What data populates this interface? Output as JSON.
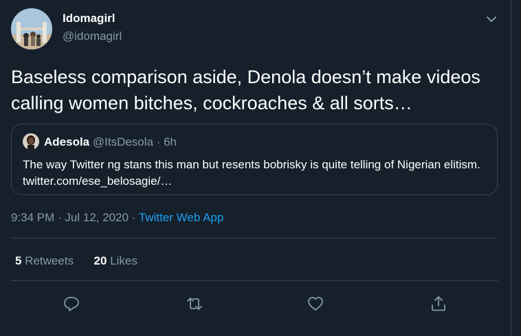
{
  "tweet": {
    "author_name": "Idomagirl",
    "author_handle": "@idomagirl",
    "text": "Baseless comparison aside, Denola doesn’t make videos calling women bitches, cockroaches & all sorts…",
    "timestamp": "9:34 PM · Jul 12, 2020 · ",
    "source": "Twitter Web App"
  },
  "quoted": {
    "name": "Adesola",
    "meta": "@ItsDesola · 6h",
    "text": "The way Twitter ng stans this man but resents bobrisky is quite telling of Nigerian elitism. twitter.com/ese_belosagie/…"
  },
  "stats": {
    "retweets_count": "5",
    "retweets_label": "Retweets",
    "likes_count": "20",
    "likes_label": "Likes"
  },
  "icons": [
    "chevron-down-icon",
    "reply-icon",
    "retweet-icon",
    "like-icon",
    "share-icon"
  ],
  "colors": {
    "background": "#15202b",
    "text": "#ffffff",
    "secondary_text": "#8899a6",
    "border": "#38444d",
    "link": "#1da1f2"
  }
}
